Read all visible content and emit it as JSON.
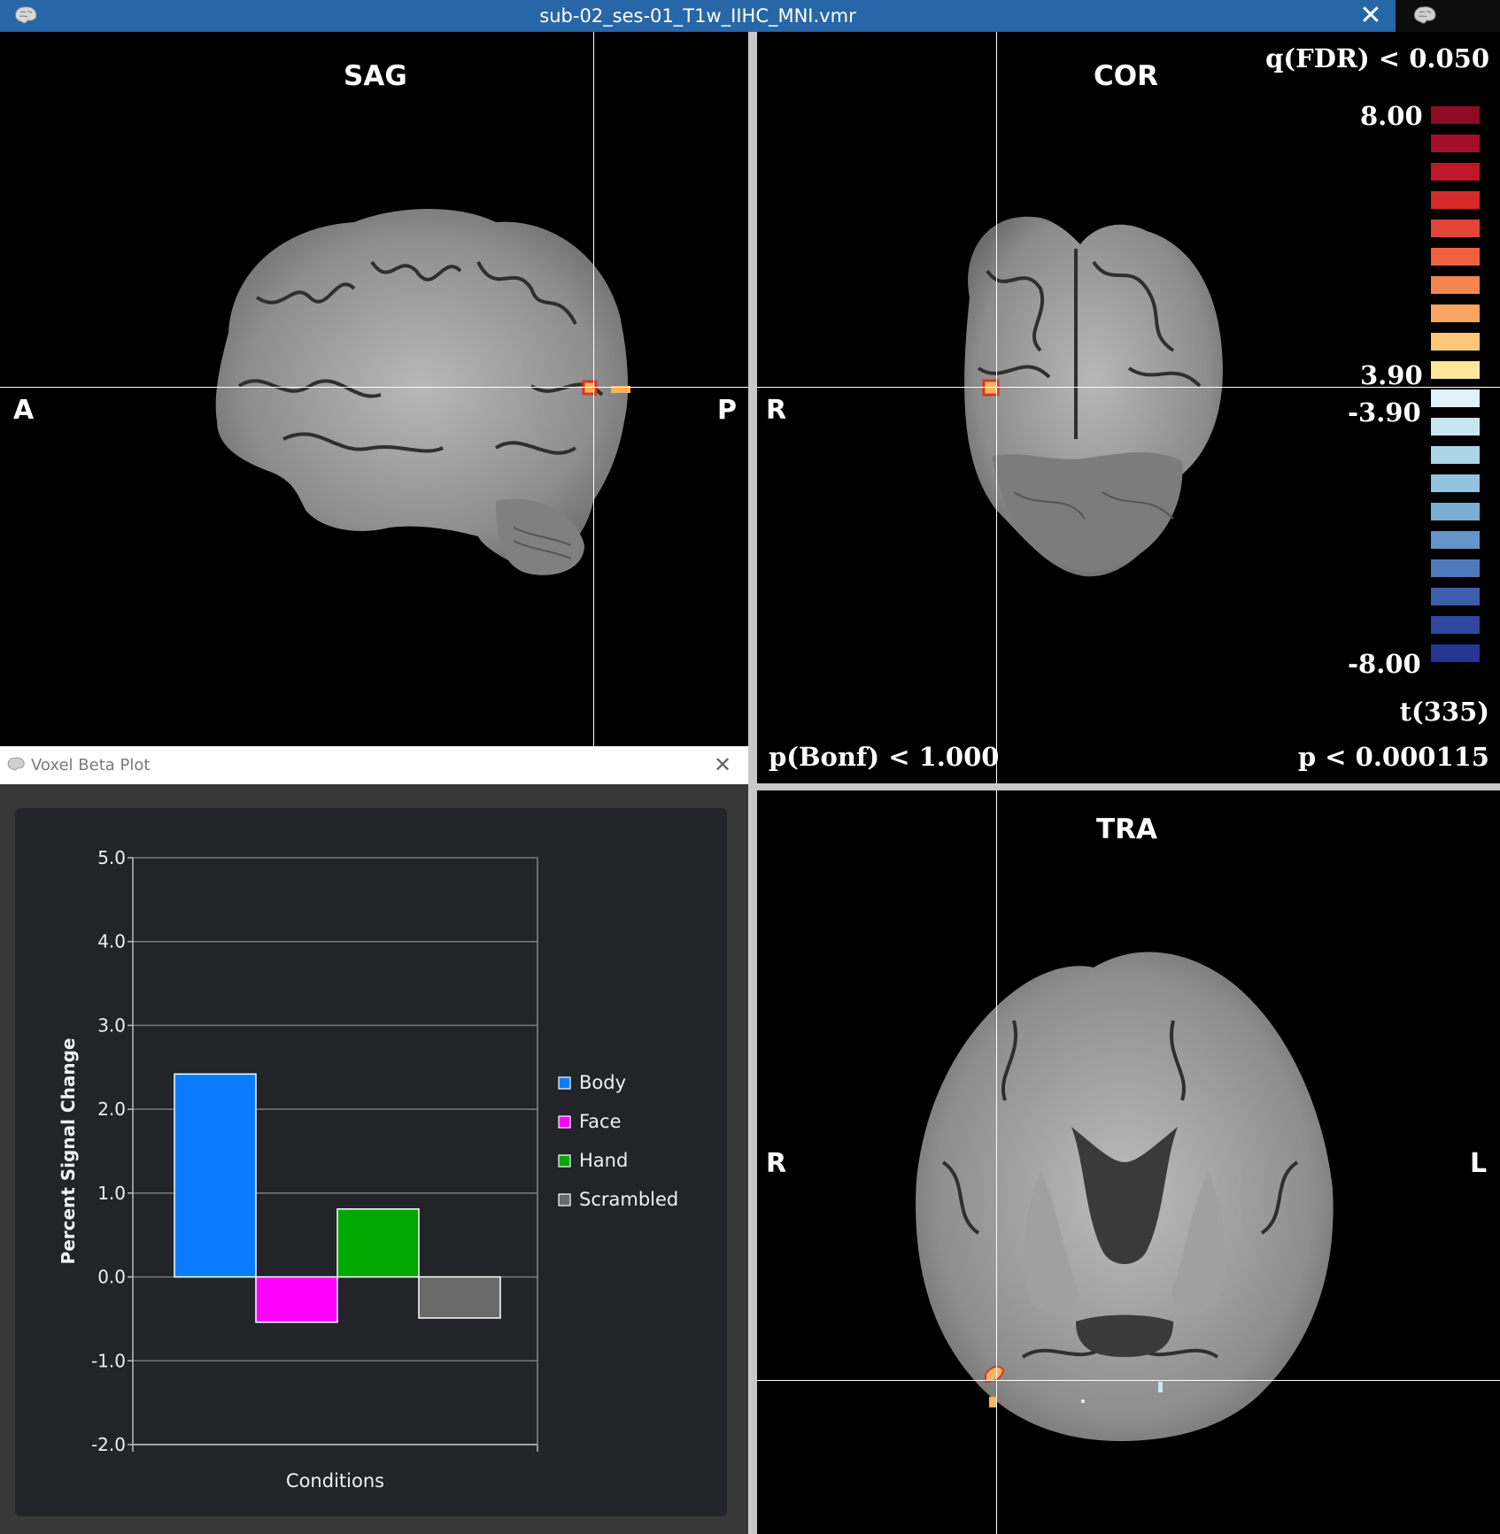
{
  "window": {
    "title": "sub-02_ses-01_T1w_IIHC_MNI.vmr",
    "close_glyph": "✕"
  },
  "views": {
    "sag": {
      "label": "SAG",
      "left": "A",
      "right": "P"
    },
    "cor": {
      "label": "COR",
      "left": "R"
    },
    "tra": {
      "label": "TRA",
      "left": "R",
      "right": "L"
    }
  },
  "stats": {
    "fdr": "q(FDR) < 0.050",
    "bonf": "p(Bonf) < 1.000",
    "p": "p < 0.000115",
    "t": "t(335)",
    "scale": {
      "max": "8.00",
      "pos_thresh": "3.90",
      "neg_thresh": "-3.90",
      "min": "-8.00"
    },
    "pos_colors": [
      "#8f0a26",
      "#a50e28",
      "#c0162a",
      "#d32a2a",
      "#e2443a",
      "#ee6140",
      "#f5864f",
      "#fba660",
      "#ffc878",
      "#ffe89a"
    ],
    "neg_colors": [
      "#e1f1f6",
      "#c7e5ef",
      "#acd6e7",
      "#93c3dd",
      "#7aaed2",
      "#6494c8",
      "#4f7abb",
      "#3d5eac",
      "#2f479e",
      "#263593"
    ]
  },
  "voxel_plot": {
    "title": "Voxel Beta Plot",
    "close_glyph": "✕"
  },
  "chart_data": {
    "type": "bar",
    "xlabel": "Conditions",
    "ylabel": "Percent Signal Change",
    "ylim": [
      -2.0,
      5.0
    ],
    "yticks": [
      "-2.0",
      "-1.0",
      "0.0",
      "1.0",
      "2.0",
      "3.0",
      "4.0",
      "5.0"
    ],
    "grid": true,
    "legend": "right",
    "series": [
      {
        "name": "Body",
        "value": 2.42,
        "color": "#0a7bff"
      },
      {
        "name": "Face",
        "value": -0.54,
        "color": "#ff00ff"
      },
      {
        "name": "Hand",
        "value": 0.81,
        "color": "#00a800"
      },
      {
        "name": "Scrambled",
        "value": -0.49,
        "color": "#696969"
      }
    ]
  }
}
